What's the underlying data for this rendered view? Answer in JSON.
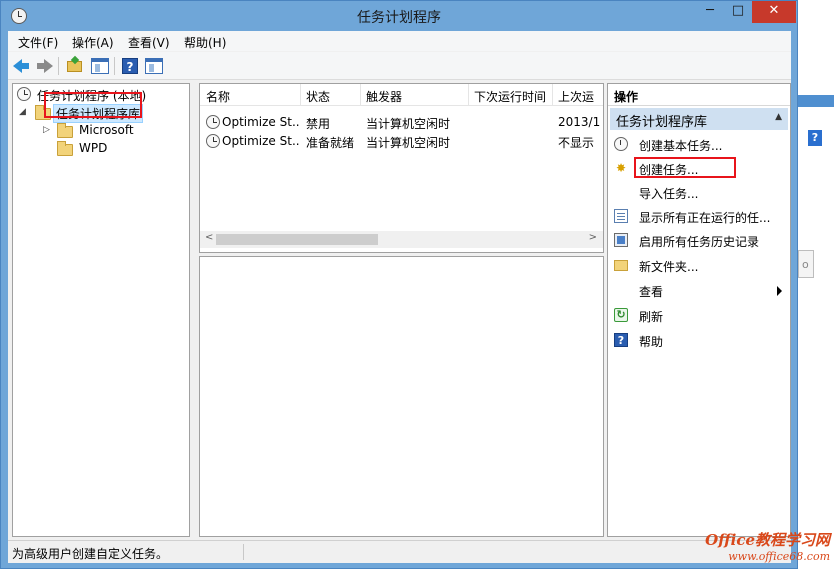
{
  "window": {
    "title": "任务计划程序",
    "min_glyph": "─",
    "max_glyph": "□",
    "close_glyph": "✕"
  },
  "menu": [
    "文件(F)",
    "操作(A)",
    "查看(V)",
    "帮助(H)"
  ],
  "tree": {
    "root": "任务计划程序 (本地)",
    "library": "任务计划程序库",
    "children": [
      "Microsoft",
      "WPD"
    ],
    "expander_open": "◢",
    "expander_closed": "▷"
  },
  "list": {
    "columns": [
      "名称",
      "状态",
      "触发器",
      "下次运行时间",
      "上次运"
    ],
    "rows": [
      {
        "name": "Optimize St...",
        "status": "禁用",
        "trigger": "当计算机空闲时",
        "next": "",
        "last": "2013/1"
      },
      {
        "name": "Optimize St...",
        "status": "准备就绪",
        "trigger": "当计算机空闲时",
        "next": "",
        "last": "不显示"
      }
    ],
    "scroll_left": "<",
    "scroll_right": ">"
  },
  "actions": {
    "header": "操作",
    "section": "任务计划程序库",
    "section_caret": "▲",
    "items": [
      {
        "label": "创建基本任务...",
        "icon": "clock-icon"
      },
      {
        "label": "创建任务...",
        "icon": "new-task-icon"
      },
      {
        "label": "导入任务...",
        "icon": ""
      },
      {
        "label": "显示所有正在运行的任...",
        "icon": "list-icon"
      },
      {
        "label": "启用所有任务历史记录",
        "icon": "history-icon"
      },
      {
        "label": "新文件夹...",
        "icon": "folder-icon"
      },
      {
        "label": "查看",
        "icon": ""
      },
      {
        "label": "刷新",
        "icon": "refresh-icon"
      },
      {
        "label": "帮助",
        "icon": "help-icon"
      }
    ]
  },
  "status": {
    "text": "为高级用户创建自定义任务。"
  },
  "toolbar": {
    "help_glyph": "?"
  },
  "background": {
    "help_glyph": "?",
    "stub": "o"
  },
  "watermark": {
    "main": "Office教程学习网",
    "url": "www.office68.com"
  },
  "icon_glyphs": {
    "new_task": "✸",
    "refresh": "↻",
    "help": "?"
  },
  "colors": {
    "close": "#c7392b",
    "highlight_box": "#e8141b",
    "section_bg": "#cfe0f1",
    "selection": "#cce8ff"
  }
}
